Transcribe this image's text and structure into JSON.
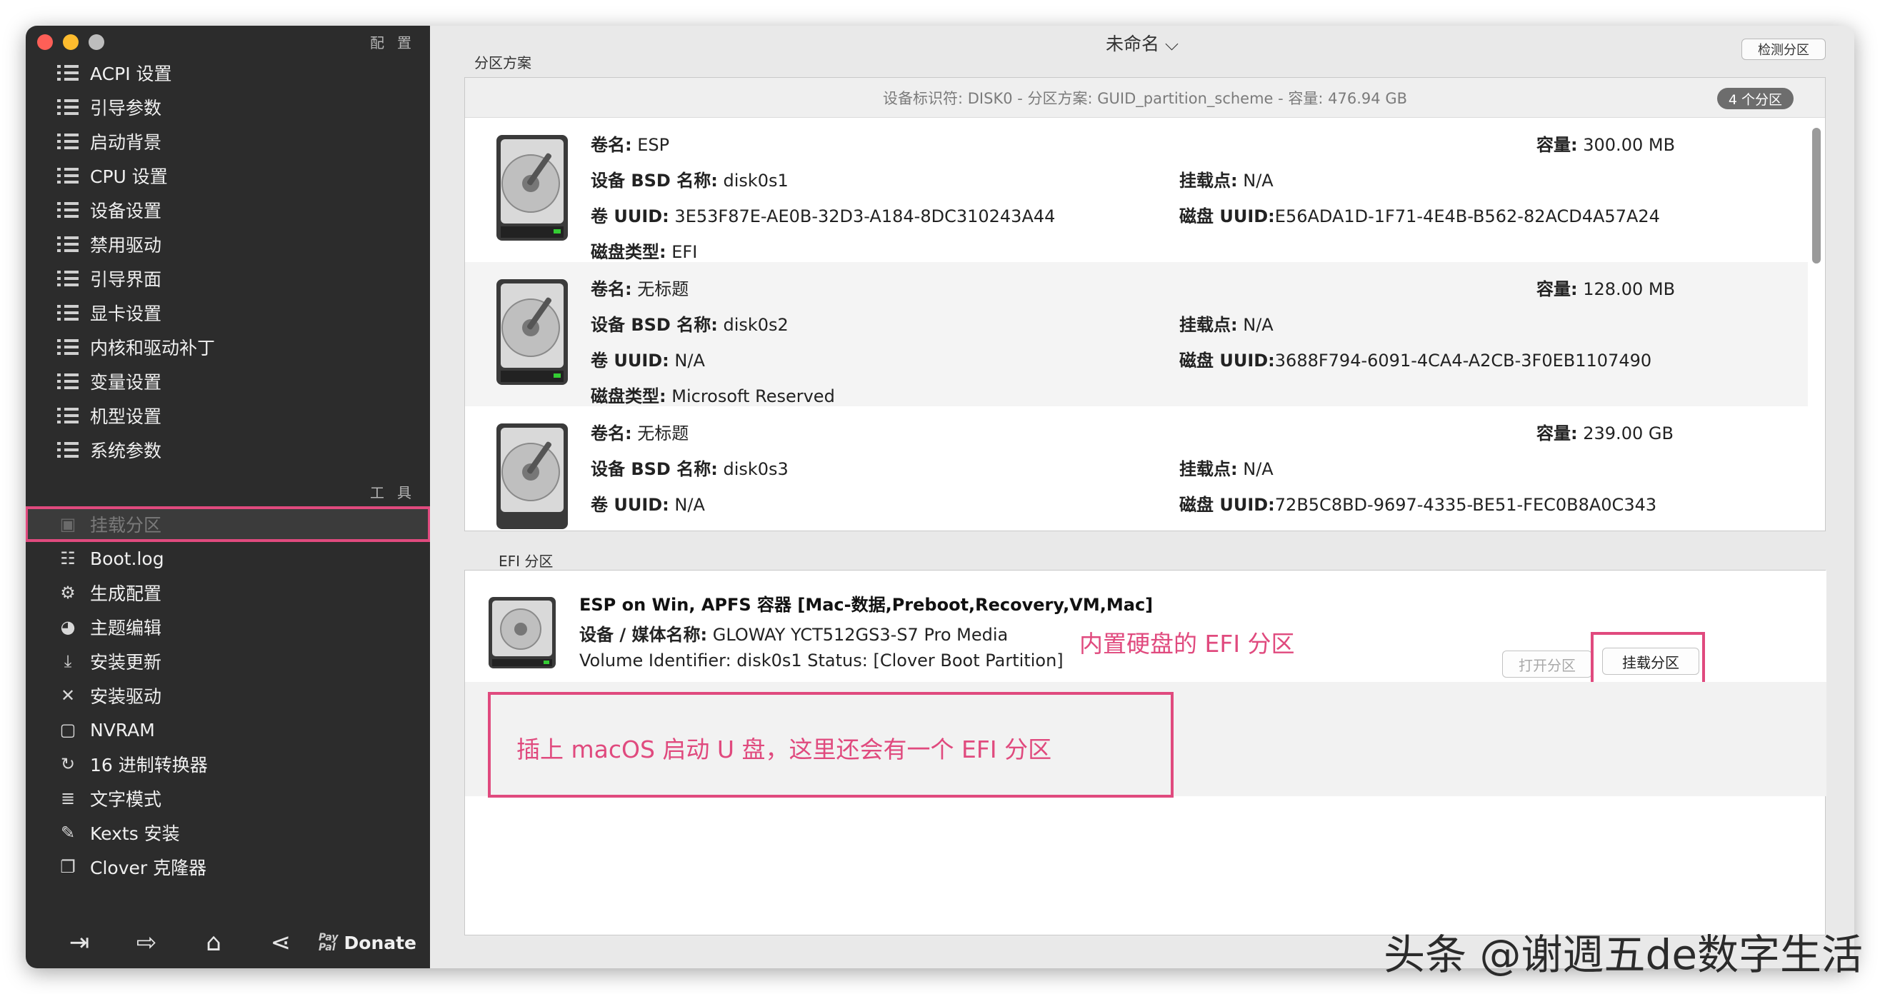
{
  "window": {
    "title": "未命名 ⌵"
  },
  "sidebar": {
    "config_header": "配置",
    "tools_header": "工具",
    "config_items": [
      {
        "label": "ACPI 设置"
      },
      {
        "label": "引导参数"
      },
      {
        "label": "启动背景"
      },
      {
        "label": "CPU 设置"
      },
      {
        "label": "设备设置"
      },
      {
        "label": "禁用驱动"
      },
      {
        "label": "引导界面"
      },
      {
        "label": "显卡设置"
      },
      {
        "label": "内核和驱动补丁"
      },
      {
        "label": "变量设置"
      },
      {
        "label": "机型设置"
      },
      {
        "label": "系统参数"
      }
    ],
    "tool_items": [
      {
        "label": "挂载分区",
        "icon": "disk-icon",
        "selected": true
      },
      {
        "label": "Boot.log",
        "icon": "log-icon"
      },
      {
        "label": "生成配置",
        "icon": "gears-icon"
      },
      {
        "label": "主题编辑",
        "icon": "palette-icon"
      },
      {
        "label": "安装更新",
        "icon": "download-icon"
      },
      {
        "label": "安装驱动",
        "icon": "tools-icon"
      },
      {
        "label": "NVRAM",
        "icon": "chip-icon"
      },
      {
        "label": "16 进制转换器",
        "icon": "refresh-icon"
      },
      {
        "label": "文字模式",
        "icon": "text-icon"
      },
      {
        "label": "Kexts 安装",
        "icon": "brush-icon"
      },
      {
        "label": "Clover 克隆器",
        "icon": "clone-icon"
      }
    ],
    "bottom": {
      "pay": "Pay",
      "pal": "Pal",
      "donate": "Donate"
    }
  },
  "main": {
    "detect_button": "检测分区",
    "partition_label": "分区方案",
    "header": "设备标识符: DISK0 - 分区方案: GUID_partition_scheme - 容量: 476.94 GB",
    "count_badge": "4 个分区",
    "partitions": [
      {
        "volume_label": "卷名:",
        "volume": "ESP",
        "capacity_label": "容量:",
        "capacity": "300.00 MB",
        "bsd_label": "设备 BSD 名称:",
        "bsd": "disk0s1",
        "mount_label": "挂载点:",
        "mount": "N/A",
        "uuid_label": "卷 UUID:",
        "uuid": "3E53F87E-AE0B-32D3-A184-8DC310243A44",
        "disk_uuid_label": "磁盘 UUID:",
        "disk_uuid": "E56ADA1D-1F71-4E4B-B562-82ACD4A57A24",
        "type_label": "磁盘类型:",
        "type": "EFI"
      },
      {
        "volume_label": "卷名:",
        "volume": "无标题",
        "capacity_label": "容量:",
        "capacity": "128.00 MB",
        "bsd_label": "设备 BSD 名称:",
        "bsd": "disk0s2",
        "mount_label": "挂载点:",
        "mount": "N/A",
        "uuid_label": "卷 UUID:",
        "uuid": "N/A",
        "disk_uuid_label": "磁盘 UUID:",
        "disk_uuid": "3688F794-6091-4CA4-A2CB-3F0EB1107490",
        "type_label": "磁盘类型:",
        "type": "Microsoft Reserved"
      },
      {
        "volume_label": "卷名:",
        "volume": "无标题",
        "capacity_label": "容量:",
        "capacity": "239.00 GB",
        "bsd_label": "设备 BSD 名称:",
        "bsd": "disk0s3",
        "mount_label": "挂载点:",
        "mount": "N/A",
        "uuid_label": "卷 UUID:",
        "uuid": "N/A",
        "disk_uuid_label": "磁盘 UUID:",
        "disk_uuid": "72B5C8BD-9697-4335-BE51-FEC0B8A0C343",
        "type_label": "",
        "type": ""
      }
    ],
    "efi_label": "EFI 分区",
    "efi": {
      "title": "ESP on Win, APFS 容器 [Mac-数据,Preboot,Recovery,VM,Mac]",
      "media_label": "设备 / 媒体名称:",
      "media": "GLOWAY YCT512GS3-S7 Pro Media",
      "volume_line": "Volume Identifier: disk0s1 Status: [Clover Boot Partition]",
      "open_button": "打开分区",
      "mount_button": "挂载分区"
    },
    "annotations": {
      "internal": "内置硬盘的 EFI 分区",
      "usb": "插上 macOS 启动 U 盘，这里还会有一个 EFI 分区"
    }
  },
  "watermark": "头条 @谢週五de数字生活",
  "colors": {
    "sidebar_bg": "#2c2c2c",
    "highlight": "#e04a7e"
  }
}
